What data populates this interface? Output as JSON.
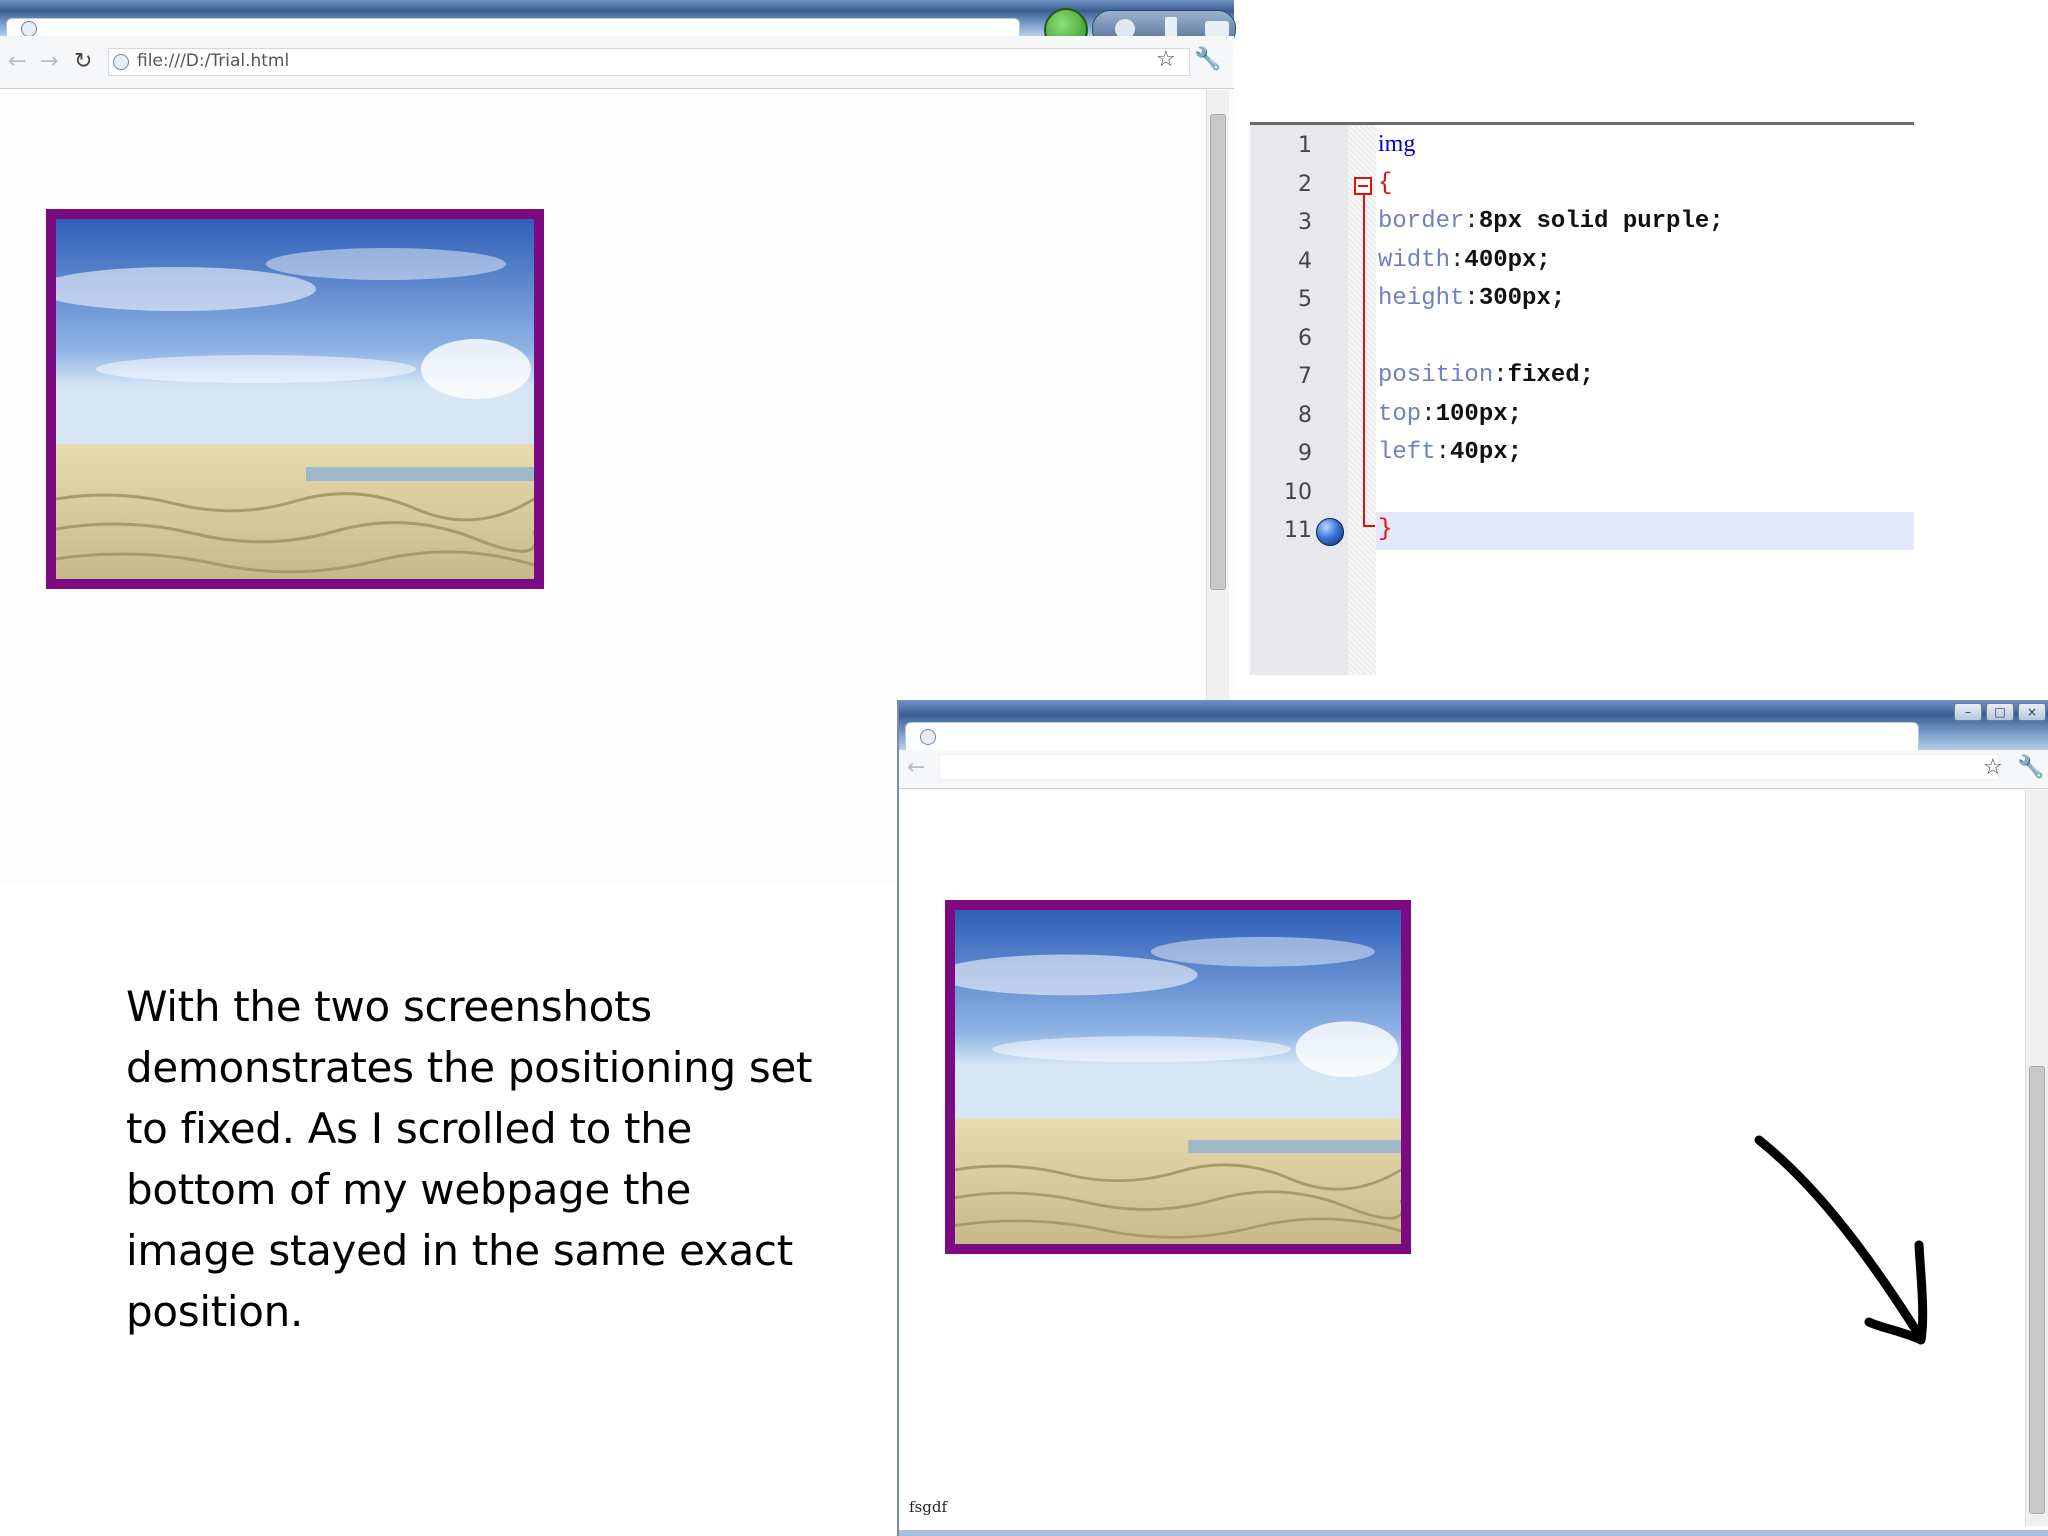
{
  "browser1": {
    "address": "file:///D:/Trial.html"
  },
  "editor": {
    "line_numbers": [
      "1",
      "2",
      "3",
      "4",
      "5",
      "6",
      "7",
      "8",
      "9",
      "10",
      "11"
    ],
    "lines": [
      {
        "text": "img",
        "kind": "selector"
      },
      {
        "text": "{",
        "kind": "brace"
      },
      {
        "property": "border",
        "value": "8px solid purple;"
      },
      {
        "property": "width",
        "value": "400px;"
      },
      {
        "property": "height",
        "value": "300px;"
      },
      {
        "text": "",
        "kind": "blank"
      },
      {
        "property": "position",
        "value": "fixed;"
      },
      {
        "property": "top",
        "value": "100px;"
      },
      {
        "property": "left",
        "value": "40px;"
      },
      {
        "text": "",
        "kind": "blank"
      },
      {
        "text": "}",
        "kind": "brace"
      }
    ]
  },
  "explanation": "With the two screenshots\ndemonstrates the  positioning set\nto fixed. As I scrolled to the\nbottom of my webpage the\nimage stayed in the same exact\nposition.",
  "browser2": {
    "footer_text": "fsgdf"
  },
  "icons": {
    "chrome_reload": "reload-icon",
    "bookmark_star": "star-icon",
    "wrench": "wrench-icon",
    "arrow": "hand-drawn-arrow"
  },
  "colors": {
    "image_border": "#7c0a82",
    "fold_marker": "#e01010",
    "selector_blue": "#0000c8"
  }
}
